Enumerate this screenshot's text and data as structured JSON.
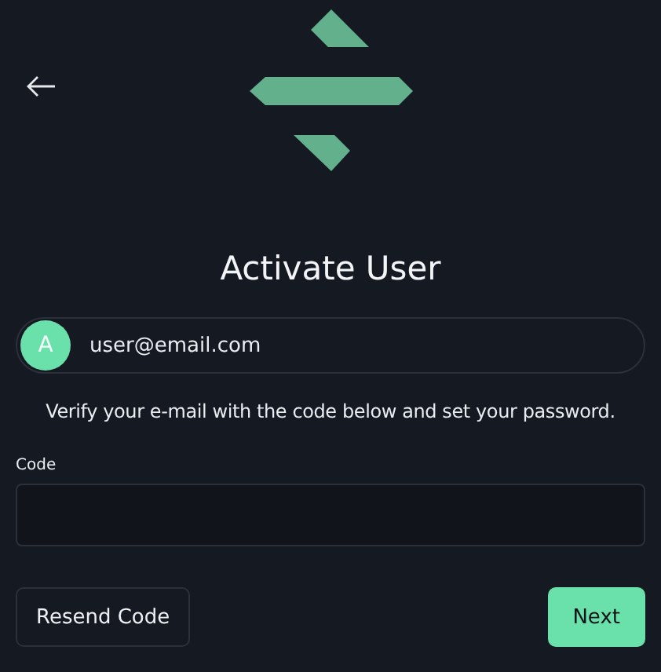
{
  "title": "Activate User",
  "account": {
    "initial": "A",
    "email": "user@email.com"
  },
  "description": "Verify your e-mail with the code below and set your password.",
  "code_field": {
    "label": "Code"
  },
  "buttons": [
    {
      "label": "Resend Code",
      "kind": "secondary"
    },
    {
      "label": "Next",
      "kind": "primary"
    }
  ]
}
